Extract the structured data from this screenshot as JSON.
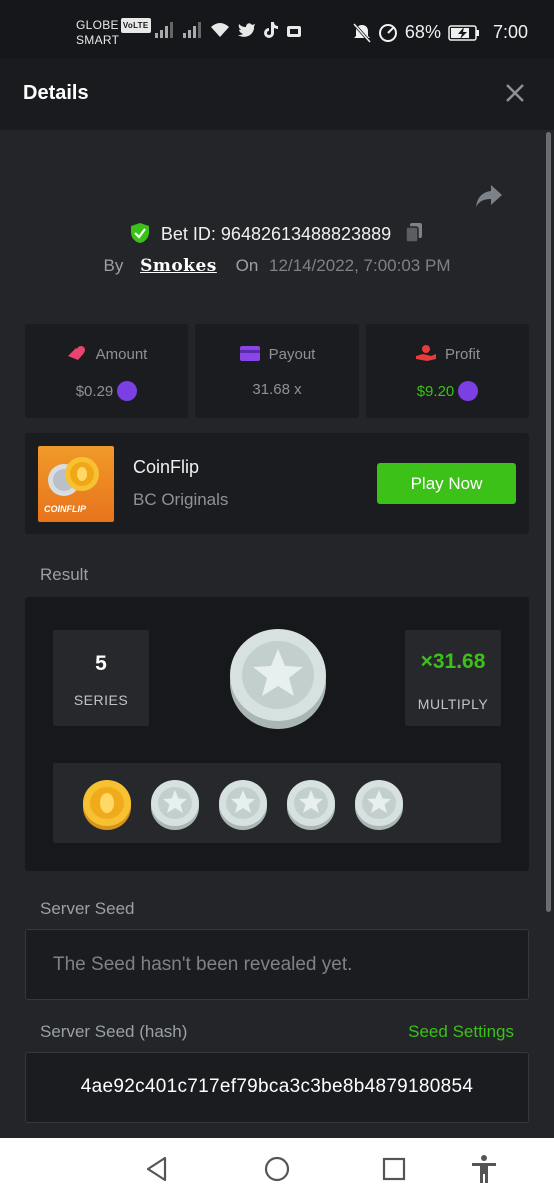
{
  "status_bar": {
    "carrier_line1": "GLOBE",
    "volte": "VoLTE",
    "carrier_line2": "SMART",
    "battery_percent": "68%",
    "time": "7:00"
  },
  "header": {
    "title": "Details"
  },
  "bet": {
    "id_label": "Bet ID:",
    "id_value": "96482613488823889",
    "by_label": "By",
    "username": "Smokes",
    "on_label": "On",
    "datetime": "12/14/2022, 7:00:03 PM"
  },
  "stats": {
    "amount": {
      "label": "Amount",
      "value": "$0.29"
    },
    "payout": {
      "label": "Payout",
      "value": "31.68 x"
    },
    "profit": {
      "label": "Profit",
      "value": "$9.20"
    }
  },
  "game": {
    "name": "CoinFlip",
    "provider": "BC Originals",
    "thumb_label": "COINFLIP",
    "play_label": "Play Now"
  },
  "result": {
    "section_label": "Result",
    "series_value": "5",
    "series_label": "SERIES",
    "multiplier_value": "×31.68",
    "multiplier_label": "MULTIPLY",
    "flips": [
      "gold",
      "silver",
      "silver",
      "silver",
      "silver"
    ]
  },
  "server_seed": {
    "label": "Server Seed",
    "placeholder": "The Seed hasn't been revealed yet."
  },
  "server_seed_hash": {
    "label": "Server Seed (hash)",
    "settings_link": "Seed Settings",
    "value": "4ae92c401c717ef79bca3c3be8b4879180854"
  },
  "colors": {
    "accent_green": "#3bc117",
    "background": "#232528",
    "card": "#1b1c1f",
    "coin_badge": "#7b3fe4"
  }
}
